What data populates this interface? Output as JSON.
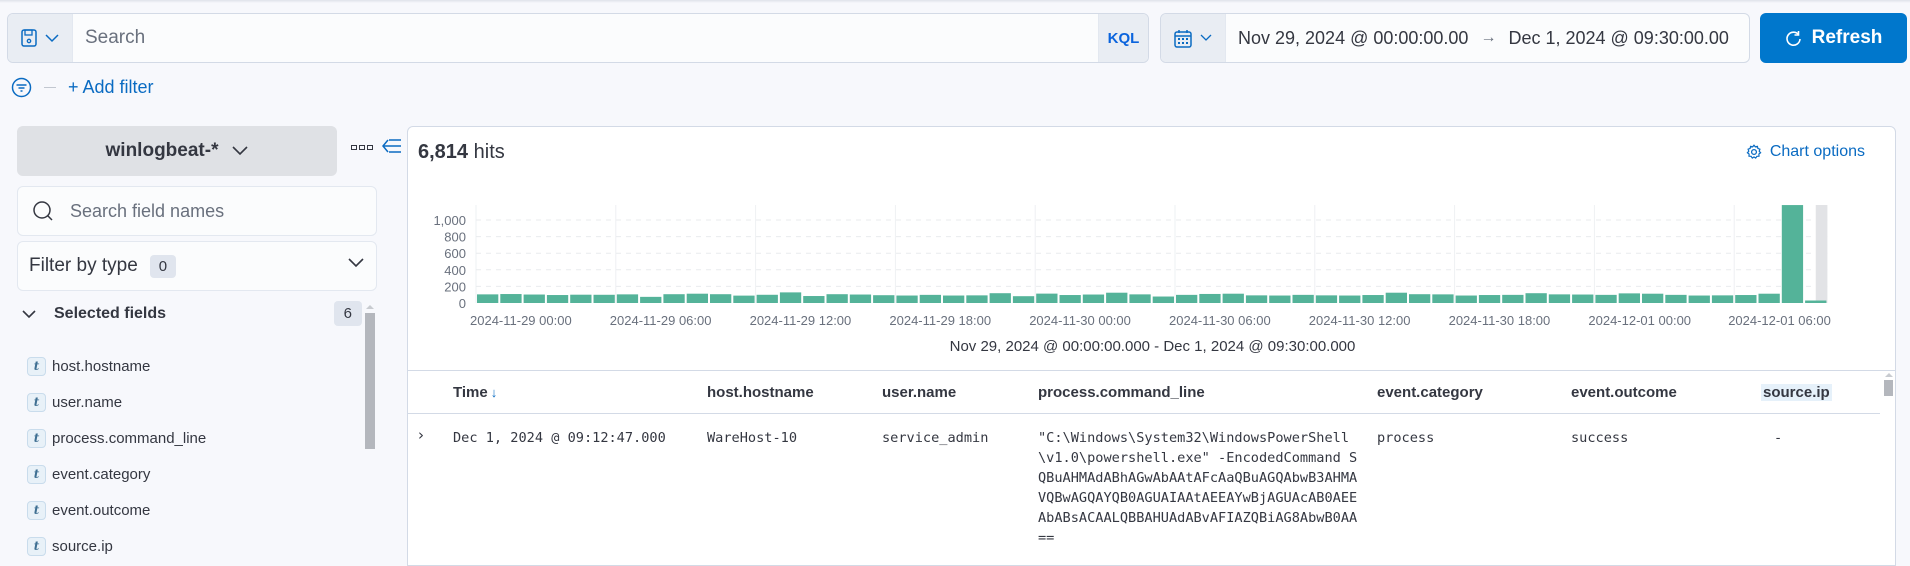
{
  "query_bar": {
    "saved_query_icon": "save-icon",
    "search_placeholder": "Search",
    "search_value": "",
    "language_label": "KQL"
  },
  "date_picker": {
    "icon": "calendar-icon",
    "start": "Nov 29, 2024 @ 00:00:00.00",
    "arrow": "→",
    "end": "Dec 1, 2024 @ 09:30:00.00"
  },
  "refresh_button": {
    "label": "Refresh",
    "icon": "refresh-icon"
  },
  "filters": {
    "add_filter_label": "+ Add filter",
    "icon": "filter-icon"
  },
  "sidebar": {
    "index_pattern": "winlogbeat-*",
    "field_search_placeholder": "Search field names",
    "filter_by_type_label": "Filter by type",
    "filter_by_type_count": "0",
    "selected_fields_label": "Selected fields",
    "selected_fields_count": "6",
    "fields": [
      {
        "type": "t",
        "name": "host.hostname"
      },
      {
        "type": "t",
        "name": "user.name"
      },
      {
        "type": "t",
        "name": "process.command_line"
      },
      {
        "type": "t",
        "name": "event.category"
      },
      {
        "type": "t",
        "name": "event.outcome"
      },
      {
        "type": "t",
        "name": "source.ip"
      }
    ]
  },
  "main": {
    "hits_count": "6,814",
    "hits_label": "hits",
    "chart_options_label": "Chart options",
    "chart_range_label": "Nov 29, 2024 @ 00:00:00.000 - Dec 1, 2024 @ 09:30:00.000"
  },
  "chart_data": {
    "type": "bar",
    "title": "",
    "xlabel": "",
    "ylabel": "",
    "interval": "1 hour",
    "x_start": "2024-11-29 00:00",
    "ylim": [
      0,
      1200
    ],
    "y_ticks": [
      "0",
      "200",
      "400",
      "600",
      "800",
      "1,000"
    ],
    "y_tick_values": [
      0,
      200,
      400,
      600,
      800,
      1000
    ],
    "x_tick_labels": [
      "2024-11-29 00:00",
      "2024-11-29 06:00",
      "2024-11-29 12:00",
      "2024-11-29 18:00",
      "2024-11-30 00:00",
      "2024-11-30 06:00",
      "2024-11-30 12:00",
      "2024-11-30 18:00",
      "2024-12-01 00:00",
      "2024-12-01 06:00"
    ],
    "x_tick_hours": [
      0,
      6,
      12,
      18,
      24,
      30,
      36,
      42,
      48,
      54
    ],
    "grid": true,
    "partial_bucket_from_hour": 57.5,
    "range_end_hour": 58,
    "bar_color": "#54b399",
    "values": [
      104,
      108,
      102,
      96,
      100,
      99,
      104,
      74,
      106,
      112,
      106,
      89,
      99,
      128,
      84,
      106,
      102,
      94,
      90,
      98,
      90,
      92,
      118,
      82,
      113,
      96,
      102,
      124,
      104,
      78,
      98,
      109,
      112,
      92,
      90,
      98,
      92,
      90,
      96,
      124,
      106,
      104,
      90,
      96,
      98,
      118,
      104,
      102,
      98,
      116,
      112,
      98,
      90,
      92,
      96,
      112,
      1180,
      30
    ]
  },
  "table": {
    "columns": [
      {
        "label": "Time",
        "sort": "↓"
      },
      {
        "label": "host.hostname"
      },
      {
        "label": "user.name"
      },
      {
        "label": "process.command_line"
      },
      {
        "label": "event.category"
      },
      {
        "label": "event.outcome"
      },
      {
        "label": "source.ip"
      }
    ],
    "rows": [
      {
        "time": "Dec 1, 2024 @ 09:12:47.000",
        "host_hostname": "WareHost-10",
        "user_name": "service_admin",
        "process_command_line": "\"C:\\Windows\\System32\\WindowsPowerShell\\v1.0\\powershell.exe\" -EncodedCommand SQBuAHMAdABhAGwAbAAtAFcAaQBuAGQAbwB3AHMAVQBwAGQAYQB0AGUAIAAtAEEAYwBjAGUAcAB0AEEAbABsACAALQBBAHUAdABvAFIAZQBiAG8AbwB0AA==",
        "event_category": "process",
        "event_outcome": "success",
        "source_ip": "-"
      }
    ]
  }
}
